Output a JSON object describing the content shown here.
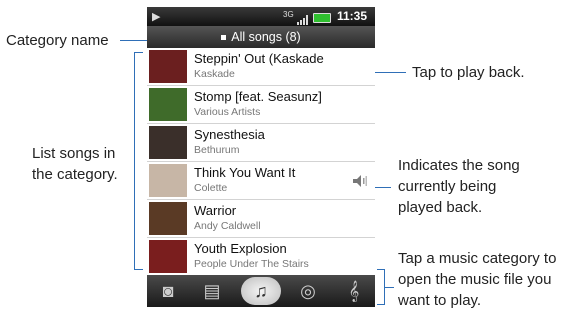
{
  "status": {
    "time": "11:35",
    "network": "3G"
  },
  "category_bar": {
    "label": "All songs (8)"
  },
  "songs": [
    {
      "title": "Steppin' Out (Kaskade",
      "artist": "Kaskade",
      "thumb_color": "#6b1f1f"
    },
    {
      "title": "Stomp [feat. Seasunz]",
      "artist": "Various Artists",
      "thumb_color": "#3f6b2a"
    },
    {
      "title": "Synesthesia",
      "artist": "Bethurum",
      "thumb_color": "#3a2f2a"
    },
    {
      "title": "Think You Want It",
      "artist": "Colette",
      "thumb_color": "#c7b6a6",
      "playing": true
    },
    {
      "title": "Warrior",
      "artist": "Andy Caldwell",
      "thumb_color": "#5a3a25"
    },
    {
      "title": "Youth Explosion",
      "artist": "People Under The Stairs",
      "thumb_color": "#7a1e1e"
    }
  ],
  "tabs": [
    {
      "name": "tab-artists",
      "icon": "speaker-box-icon",
      "glyph": "◙"
    },
    {
      "name": "tab-albums",
      "icon": "album-play-icon",
      "glyph": "▤"
    },
    {
      "name": "tab-songs",
      "icon": "music-note-icon",
      "glyph": "♫",
      "active": true
    },
    {
      "name": "tab-playlists",
      "icon": "disc-icon",
      "glyph": "◎"
    },
    {
      "name": "tab-genres",
      "icon": "treble-clef-icon",
      "glyph": "𝄞"
    }
  ],
  "callouts": {
    "category_name": "Category name",
    "list_songs_l1": "List songs in",
    "list_songs_l2": "the category.",
    "tap_play": "Tap to play back.",
    "indicates_l1": "Indicates the song",
    "indicates_l2": "currently being",
    "indicates_l3": "played back.",
    "tap_category_l1": "Tap a music category to",
    "tap_category_l2": "open the music file you",
    "tap_category_l3": "want to play."
  },
  "colors": {
    "callout_line": "#2f6fb7",
    "accent_green": "#2fbf2f"
  }
}
